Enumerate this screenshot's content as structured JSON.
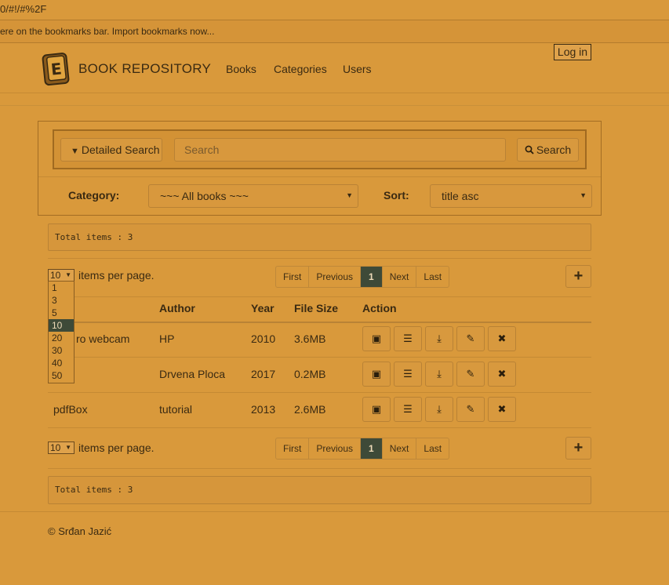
{
  "browser": {
    "url_text": "0/#!/#%2F",
    "bookmarks_text": "ere on the bookmarks bar. Import bookmarks now..."
  },
  "nav": {
    "brand": "BOOK REPOSITORY",
    "links": [
      "Books",
      "Categories",
      "Users"
    ],
    "login": "Log in"
  },
  "search": {
    "detailed_label": "Detailed Search",
    "placeholder": "Search",
    "button_label": "Search",
    "category_label": "Category:",
    "category_value": "~~~ All books ~~~",
    "sort_label": "Sort:",
    "sort_value": "title asc"
  },
  "summary": {
    "total_text": "Total items : 3"
  },
  "pagination": {
    "per_page_value": "10",
    "per_page_label": "items per page.",
    "per_page_options": [
      "1",
      "3",
      "5",
      "10",
      "20",
      "30",
      "40",
      "50"
    ],
    "selected_option": "10",
    "first": "First",
    "previous": "Previous",
    "current": "1",
    "next": "Next",
    "last": "Last",
    "add": "+"
  },
  "table": {
    "headers": [
      "Author",
      "Year",
      "File Size",
      "Action"
    ],
    "rows": [
      {
        "title": "ro webcam",
        "author": "HP",
        "year": "2010",
        "size": "3.6MB"
      },
      {
        "title": "",
        "author": "Drvena Ploca",
        "year": "2017",
        "size": "0.2MB"
      },
      {
        "title": "pdfBox",
        "author": "tutorial",
        "year": "2013",
        "size": "2.6MB"
      }
    ]
  },
  "footer": {
    "text": "© Srđan Jazić"
  }
}
